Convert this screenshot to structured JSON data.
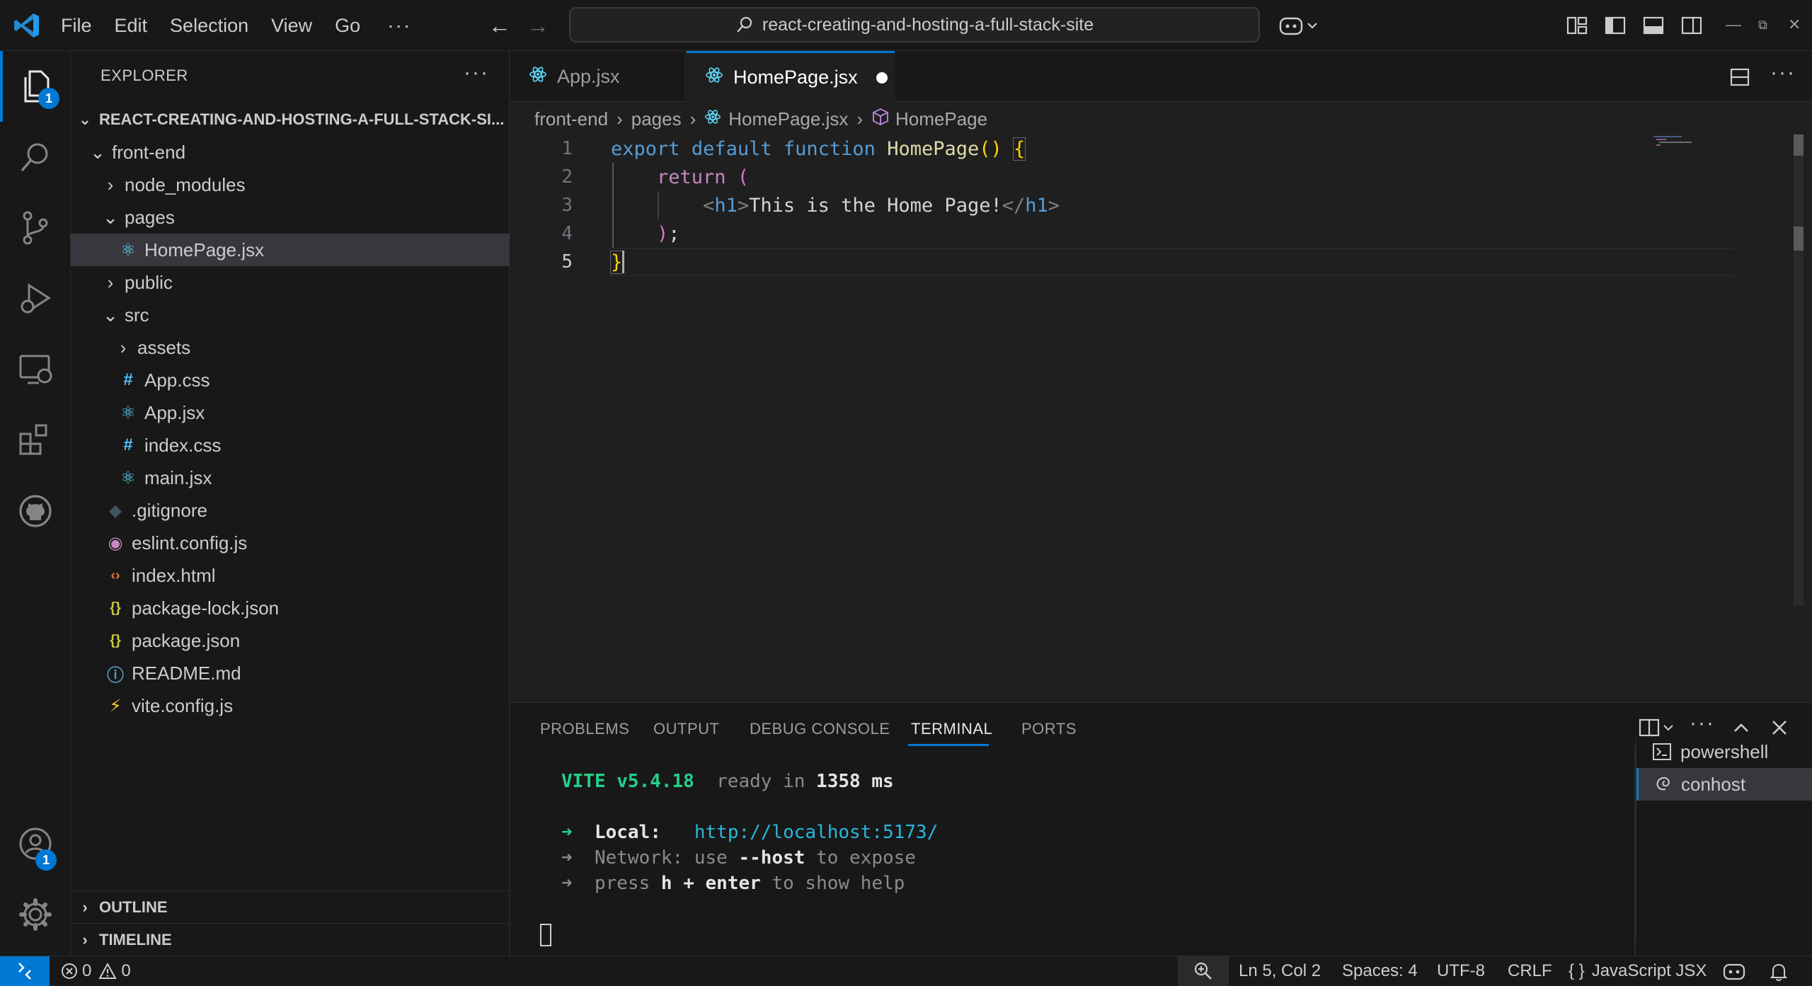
{
  "titlebar": {
    "menu": [
      "File",
      "Edit",
      "Selection",
      "View",
      "Go"
    ],
    "more": "···",
    "search_text": "react-creating-and-hosting-a-full-stack-site"
  },
  "activity": {
    "explorer_badge": "1",
    "accounts_badge": "1",
    "accent": "#0078d4"
  },
  "sidebar": {
    "title": "EXPLORER",
    "more": "···",
    "root": "REACT-CREATING-AND-HOSTING-A-FULL-STACK-SI...",
    "tree": [
      {
        "label": "front-end",
        "type": "folder-open"
      },
      {
        "label": "node_modules",
        "type": "folder"
      },
      {
        "label": "pages",
        "type": "folder-open"
      },
      {
        "label": "HomePage.jsx",
        "type": "react"
      },
      {
        "label": "public",
        "type": "folder"
      },
      {
        "label": "src",
        "type": "folder-open"
      },
      {
        "label": "assets",
        "type": "folder"
      },
      {
        "label": "App.css",
        "type": "css"
      },
      {
        "label": "App.jsx",
        "type": "react"
      },
      {
        "label": "index.css",
        "type": "css"
      },
      {
        "label": "main.jsx",
        "type": "react"
      },
      {
        "label": ".gitignore",
        "type": "git"
      },
      {
        "label": "eslint.config.js",
        "type": "eslint"
      },
      {
        "label": "index.html",
        "type": "html"
      },
      {
        "label": "package-lock.json",
        "type": "json"
      },
      {
        "label": "package.json",
        "type": "json"
      },
      {
        "label": "README.md",
        "type": "info"
      },
      {
        "label": "vite.config.js",
        "type": "vite"
      }
    ],
    "outline": "OUTLINE",
    "timeline": "TIMELINE"
  },
  "editor": {
    "tabs": [
      {
        "label": "App.jsx",
        "active": false
      },
      {
        "label": "HomePage.jsx",
        "active": true,
        "dirty": true
      }
    ],
    "breadcrumb": [
      "front-end",
      "pages",
      "HomePage.jsx",
      "HomePage"
    ],
    "line_numbers": [
      "1",
      "2",
      "3",
      "4",
      "5"
    ],
    "code": {
      "l1": {
        "export": "export",
        "default": "default",
        "function": "function",
        "name": "HomePage",
        "parens": "()",
        "brace": "{"
      },
      "l2": {
        "return": "return",
        "paren": "("
      },
      "l3": {
        "open_lt": "<",
        "open_tag": "h1",
        "open_gt": ">",
        "text": "This is the Home Page!",
        "close_lt": "</",
        "close_tag": "h1",
        "close_gt": ">"
      },
      "l4": {
        "paren": ")",
        "semi": ";"
      },
      "l5": {
        "brace": "}"
      }
    }
  },
  "panel": {
    "tabs": [
      "PROBLEMS",
      "OUTPUT",
      "DEBUG CONSOLE",
      "TERMINAL",
      "PORTS"
    ],
    "active_tab": "TERMINAL",
    "terminals": [
      "powershell",
      "conhost"
    ],
    "terminal": {
      "vite": "VITE v5.4.18",
      "ready": "ready in",
      "ms_value": "1358",
      "ms": "ms",
      "arrow": "➜",
      "local_label": "Local:",
      "local_url": "http://localhost:5173/",
      "network_label": "Network:",
      "network_use": "use",
      "network_host": "--host",
      "network_expose": "to expose",
      "press": "press",
      "h_enter": "h + enter",
      "show_help": "to show help"
    }
  },
  "statusbar": {
    "errors": "0",
    "warnings": "0",
    "position": "Ln 5, Col 2",
    "spaces": "Spaces: 4",
    "encoding": "UTF-8",
    "eol": "CRLF",
    "language": "JavaScript JSX",
    "language_icon": "{ }"
  }
}
